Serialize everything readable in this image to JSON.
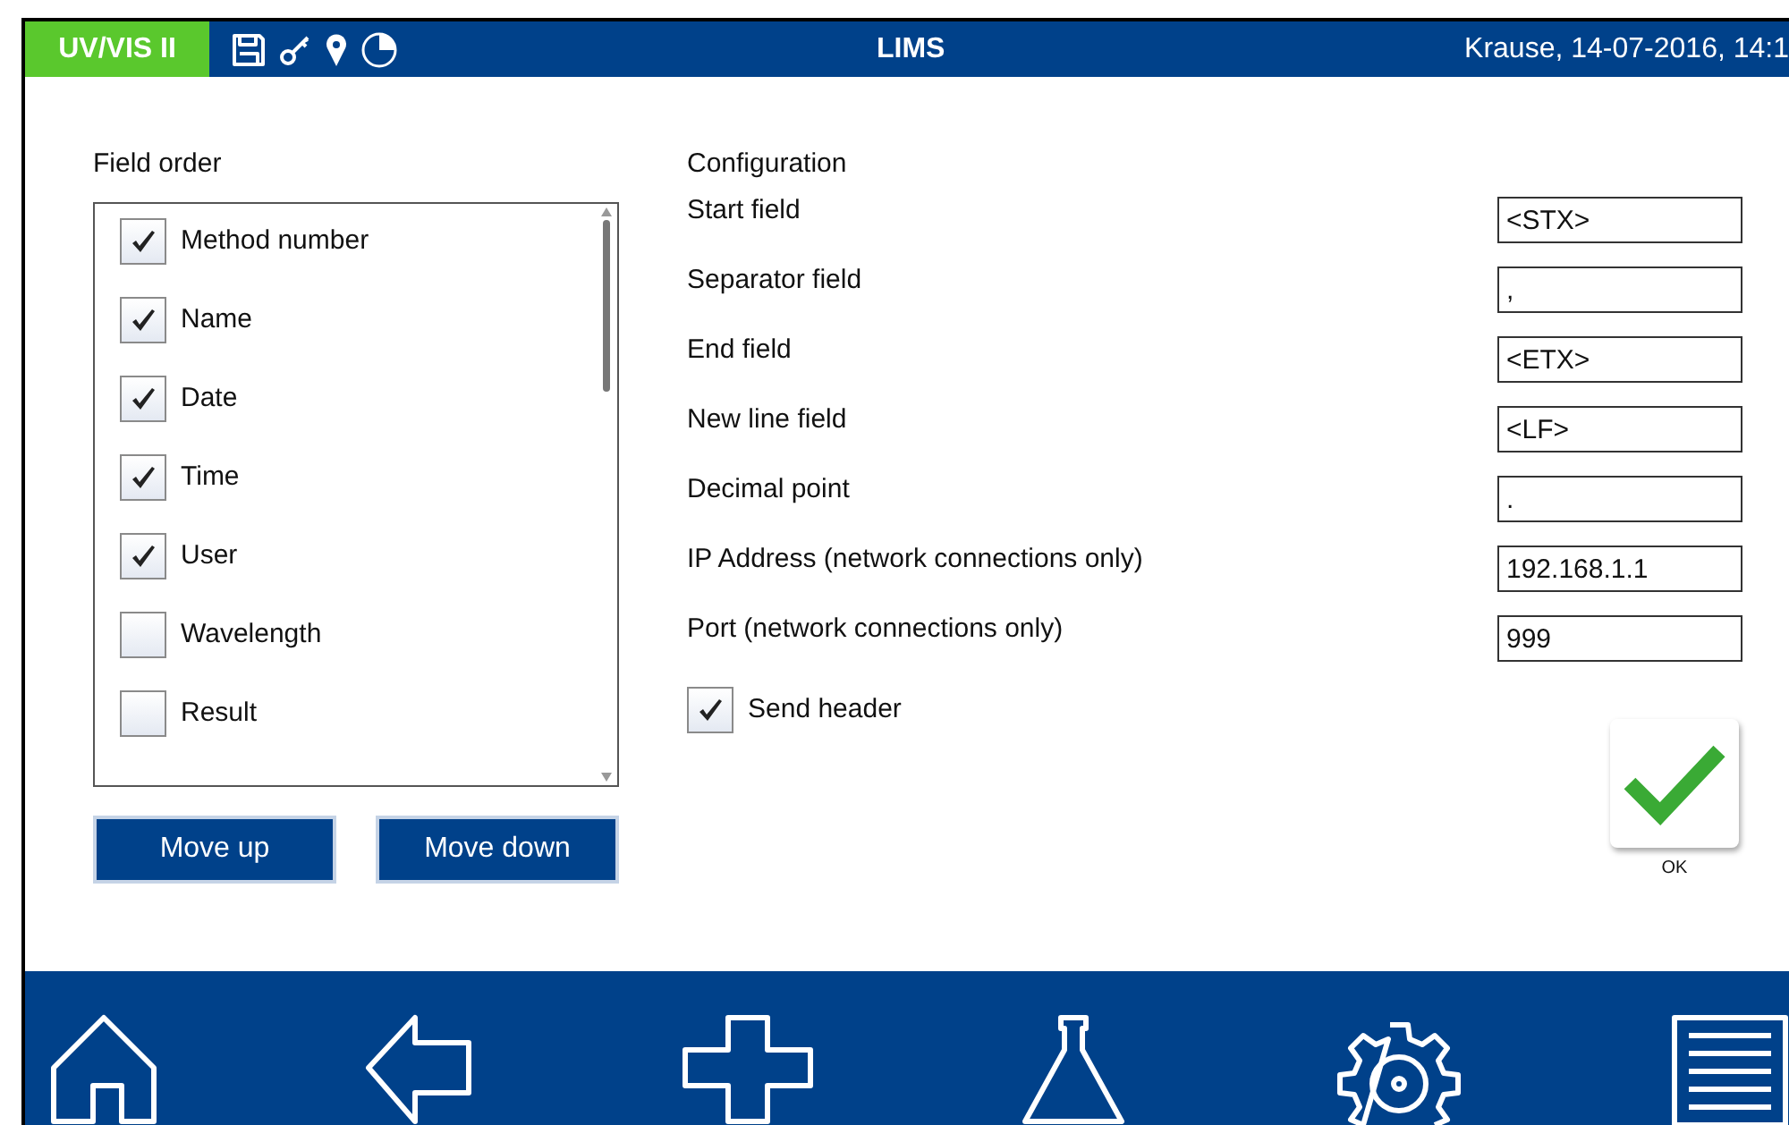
{
  "header": {
    "device": "UV/VIS II",
    "title": "LIMS",
    "user_datetime": "Krause, 14-07-2016, 14:1"
  },
  "field_order": {
    "title": "Field order",
    "items": [
      {
        "label": "Method number",
        "checked": true
      },
      {
        "label": "Name",
        "checked": true
      },
      {
        "label": "Date",
        "checked": true
      },
      {
        "label": "Time",
        "checked": true
      },
      {
        "label": "User",
        "checked": true
      },
      {
        "label": "Wavelength",
        "checked": false
      },
      {
        "label": "Result",
        "checked": false
      }
    ],
    "buttons": [
      "Move up",
      "Move down"
    ]
  },
  "configuration": {
    "title": "Configuration",
    "fields": [
      {
        "label": "Start field",
        "value": "<STX>"
      },
      {
        "label": "Separator field",
        "value": ","
      },
      {
        "label": "End field",
        "value": "<ETX>"
      },
      {
        "label": "New line field",
        "value": "<LF>"
      },
      {
        "label": "Decimal point",
        "value": "."
      },
      {
        "label": "IP Address (network connections only)",
        "value": "192.168.1.1"
      },
      {
        "label": "Port (network connections only)",
        "value": "999"
      }
    ],
    "send_header": {
      "label": "Send header",
      "checked": true
    }
  },
  "ok_button": {
    "label": "OK"
  }
}
